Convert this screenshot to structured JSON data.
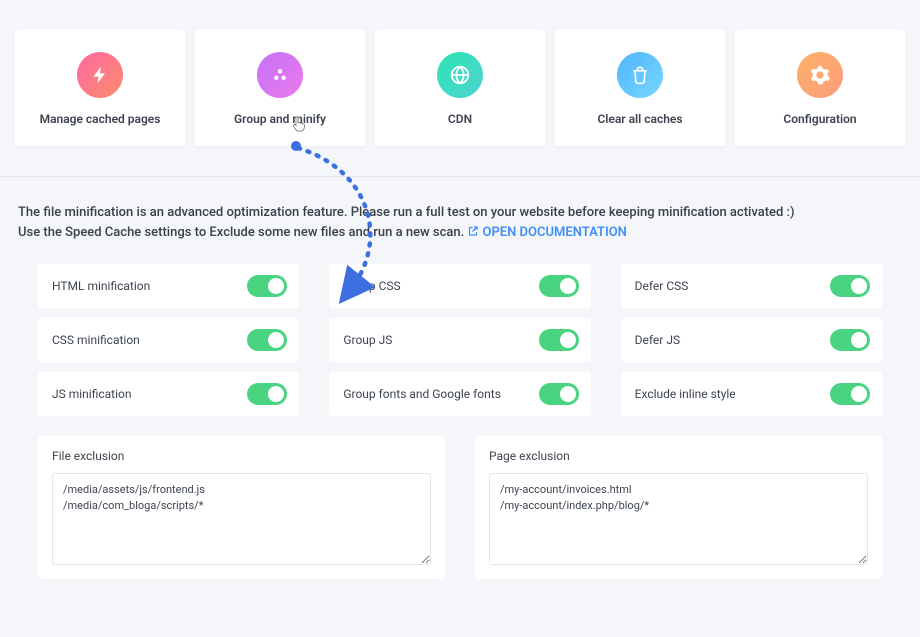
{
  "tabs": [
    {
      "label": "Manage cached pages",
      "icon": "bolt"
    },
    {
      "label": "Group and minify",
      "icon": "cluster"
    },
    {
      "label": "CDN",
      "icon": "globe"
    },
    {
      "label": "Clear all caches",
      "icon": "trash"
    },
    {
      "label": "Configuration",
      "icon": "gear"
    }
  ],
  "notice": {
    "line1": "The file minification is an advanced optimization feature. Please run a full test on your website before keeping minification activated :)",
    "line2_prefix": "Use the Speed Cache settings to Exclude some new files and run a new scan.",
    "link_label": "OPEN DOCUMENTATION"
  },
  "toggles": {
    "col1": [
      {
        "label": "HTML minification",
        "on": true
      },
      {
        "label": "CSS minification",
        "on": true
      },
      {
        "label": "JS minification",
        "on": true
      }
    ],
    "col2": [
      {
        "label": "Group CSS",
        "on": true
      },
      {
        "label": "Group JS",
        "on": true
      },
      {
        "label": "Group fonts and Google fonts",
        "on": true
      }
    ],
    "col3": [
      {
        "label": "Defer CSS",
        "on": true
      },
      {
        "label": "Defer JS",
        "on": true
      },
      {
        "label": "Exclude inline style",
        "on": true
      }
    ]
  },
  "exclusions": {
    "file": {
      "title": "File exclusion",
      "value": "/media/assets/js/frontend.js\n/media/com_bloga/scripts/*"
    },
    "page": {
      "title": "Page exclusion",
      "value": "/my-account/invoices.html\n/my-account/index.php/blog/*"
    }
  }
}
